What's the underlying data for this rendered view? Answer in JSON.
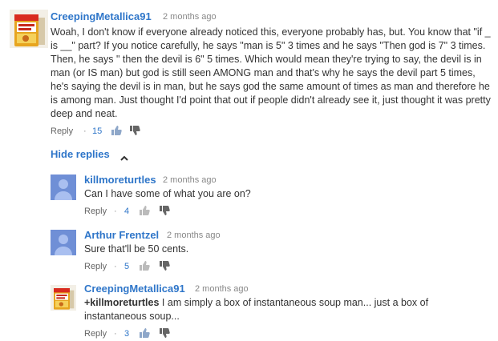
{
  "comments": [
    {
      "author": "CreepingMetallica91",
      "time": "2 months ago",
      "text": "Woah, I don't know if everyone already noticed this, everyone probably has, but. You know that \"if _ is __\" part? If you notice carefully, he says \"man is 5\" 3 times and he says \"Then god is 7\" 3 times. Then, he says \" then the devil is 6\" 5 times. Which would mean they're trying to say, the devil is in man (or IS man) but god is still seen AMONG man and that's why he says the devil part 5 times, he's saying the devil is in man, but he says god the same amount of times as man and therefore he is among man. Just thought I'd point that out if people didn't already see it, just thought it was pretty deep and neat.",
      "reply_label": "Reply",
      "dot": "·",
      "likes": "15",
      "avatar_icon": "soup-cup-avatar"
    }
  ],
  "hide_replies_label": "Hide replies",
  "replies": [
    {
      "author": "killmoreturtles",
      "time": "2 months ago",
      "text": "Can I have some of what you are on?",
      "reply_label": "Reply",
      "dot": "·",
      "likes": "4",
      "avatar_icon": "default-user-avatar"
    },
    {
      "author": "Arthur Frentzel",
      "time": "2 months ago",
      "text": "Sure that'll be 50 cents.",
      "reply_label": "Reply",
      "dot": "·",
      "likes": "5",
      "avatar_icon": "default-user-avatar"
    },
    {
      "author": "CreepingMetallica91",
      "time": "2 months ago",
      "mention": "+killmoreturtles",
      "text": " I am simply a box of instantaneous soup man... just a box of instantaneous soup...",
      "reply_label": "Reply",
      "dot": "·",
      "likes": "3",
      "avatar_icon": "soup-cup-avatar"
    }
  ],
  "colors": {
    "link": "#2f76c9",
    "text": "#333333",
    "meta": "#888888",
    "default_avatar": "#6f8fd6"
  }
}
